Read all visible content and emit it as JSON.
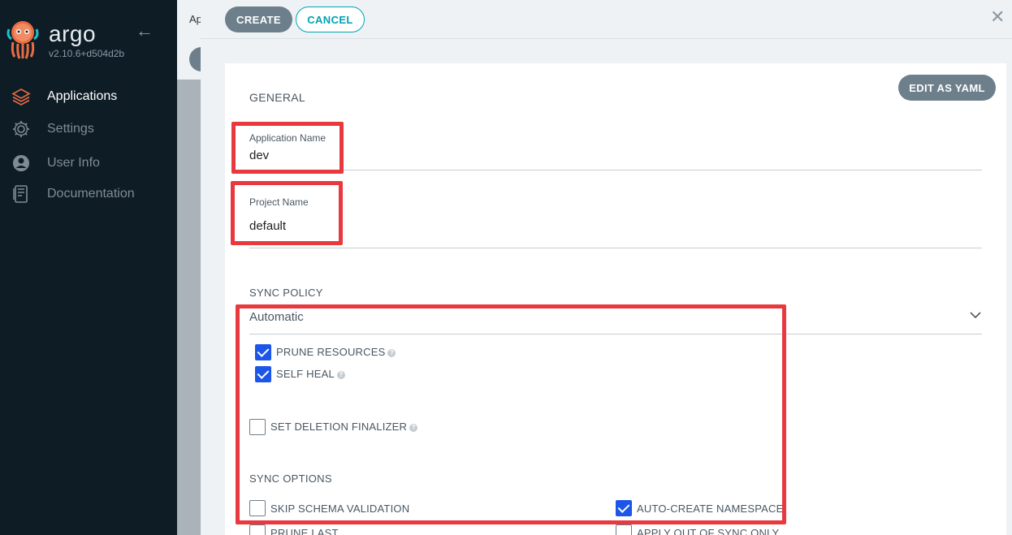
{
  "sidebar": {
    "brand": "argo",
    "version": "v2.10.6+d504d2b",
    "items": [
      {
        "label": "Applications",
        "icon": "layers-icon"
      },
      {
        "label": "Settings",
        "icon": "gear-icon"
      },
      {
        "label": "User Info",
        "icon": "user-icon"
      },
      {
        "label": "Documentation",
        "icon": "book-icon"
      }
    ]
  },
  "behind": {
    "tab_text": "Ap"
  },
  "header": {
    "create_label": "CREATE",
    "cancel_label": "CANCEL",
    "close_glyph": "✕"
  },
  "form": {
    "edit_yaml_label": "EDIT AS YAML",
    "general_title": "GENERAL",
    "app_name_label": "Application Name",
    "app_name_value": "dev",
    "project_name_label": "Project Name",
    "project_name_value": "default",
    "sync_policy_title": "SYNC POLICY",
    "sync_policy_value": "Automatic",
    "prune_resources_label": "PRUNE RESOURCES",
    "self_heal_label": "SELF HEAL",
    "set_deletion_finalizer_label": "SET DELETION FINALIZER",
    "sync_options_title": "SYNC OPTIONS",
    "skip_schema_label": "SKIP SCHEMA VALIDATION",
    "auto_create_ns_label": "AUTO-CREATE NAMESPACE",
    "prune_last_label": "PRUNE LAST",
    "apply_out_of_sync_label": "APPLY OUT OF SYNC ONLY",
    "help_glyph": "?"
  },
  "checkbox_states": {
    "prune_resources": true,
    "self_heal": true,
    "set_deletion_finalizer": false,
    "skip_schema_validation": false,
    "auto_create_namespace": true,
    "prune_last": false,
    "apply_out_of_sync_only": false
  },
  "colors": {
    "sidebar_bg": "#0e1c26",
    "accent_teal": "#00a2b3",
    "button_gray": "#6d7f8b",
    "checkbox_blue": "#1c56e8",
    "highlight_red": "#e8393f"
  }
}
